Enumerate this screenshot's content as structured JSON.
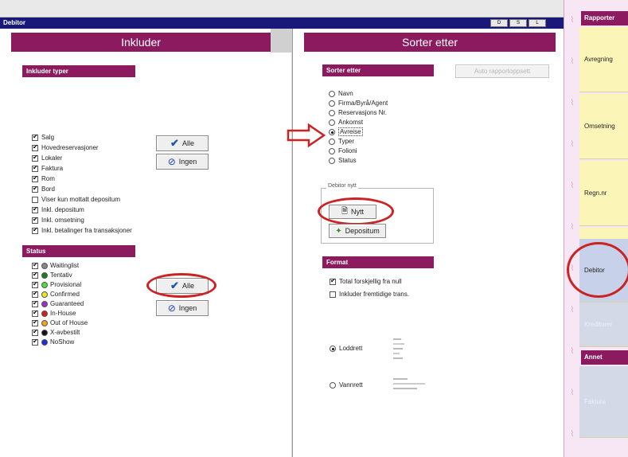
{
  "window": {
    "title": "Debitor",
    "title_buttons": [
      "D",
      "S",
      "L"
    ]
  },
  "left": {
    "header": "Inkluder",
    "types_label": "Inkluder typer",
    "types": [
      {
        "label": "Salg",
        "checked": true
      },
      {
        "label": "Hovedreservasjoner",
        "checked": true
      },
      {
        "label": "Lokaler",
        "checked": true
      },
      {
        "label": "Faktura",
        "checked": true
      },
      {
        "label": "Rom",
        "checked": true
      },
      {
        "label": "Bord",
        "checked": true
      },
      {
        "label": "Viser kun mottatt depositum",
        "checked": false
      },
      {
        "label": "Inkl. depositum",
        "checked": true
      },
      {
        "label": "Inkl. omsetning",
        "checked": true
      },
      {
        "label": "Inkl. betalinger fra transaksjoner",
        "checked": true
      }
    ],
    "types_buttons": {
      "all": "Alle",
      "none": "Ingen"
    },
    "status_label": "Status",
    "statuses": [
      {
        "label": "Waitinglist",
        "color": "#888888"
      },
      {
        "label": "Tentativ",
        "color": "#1e7a1e"
      },
      {
        "label": "Provisional",
        "color": "#55dd33"
      },
      {
        "label": "Confirmed",
        "color": "#f2e61c"
      },
      {
        "label": "Guaranteed",
        "color": "#9b2fc9"
      },
      {
        "label": "In-House",
        "color": "#d81c1c"
      },
      {
        "label": "Out of House",
        "color": "#f2a51c"
      },
      {
        "label": "X-avbestilt",
        "color": "#111111"
      },
      {
        "label": "NoShow",
        "color": "#1c2cd8"
      }
    ],
    "status_buttons": {
      "all": "Alle",
      "none": "Ingen"
    }
  },
  "right": {
    "header": "Sorter etter",
    "sort_label": "Sorter etter",
    "disabled_button": "Auto rapportoppsett",
    "sort_options": [
      {
        "label": "Navn",
        "selected": false
      },
      {
        "label": "Firma/Byrå/Agent",
        "selected": false
      },
      {
        "label": "Reservasjons Nr.",
        "selected": false
      },
      {
        "label": "Ankomst",
        "selected": false
      },
      {
        "label": "Avreise",
        "selected": true
      },
      {
        "label": "Typer",
        "selected": false
      },
      {
        "label": "Folioni",
        "selected": false
      },
      {
        "label": "Status",
        "selected": false
      }
    ],
    "debitor_group_title": "Debitor nytt",
    "debitor_buttons": {
      "nytt": "Nytt",
      "depositum": "Depositum"
    },
    "format_label": "Format",
    "format_options": [
      {
        "label": "Total forskjellig fra null",
        "checked": true
      },
      {
        "label": "Inkluder fremtidige trans.",
        "checked": false
      }
    ],
    "orientation": [
      {
        "label": "Loddrett",
        "selected": true
      },
      {
        "label": "Vannrett",
        "selected": false
      }
    ]
  },
  "nav": {
    "reports_head": "Rapporter",
    "items": [
      "Avregning",
      "Omsetning",
      "Regn.nr",
      "Transaksjoner",
      "Debitor",
      "Kreditorer"
    ],
    "other_head": "Annet",
    "other_item": "Faktura"
  }
}
